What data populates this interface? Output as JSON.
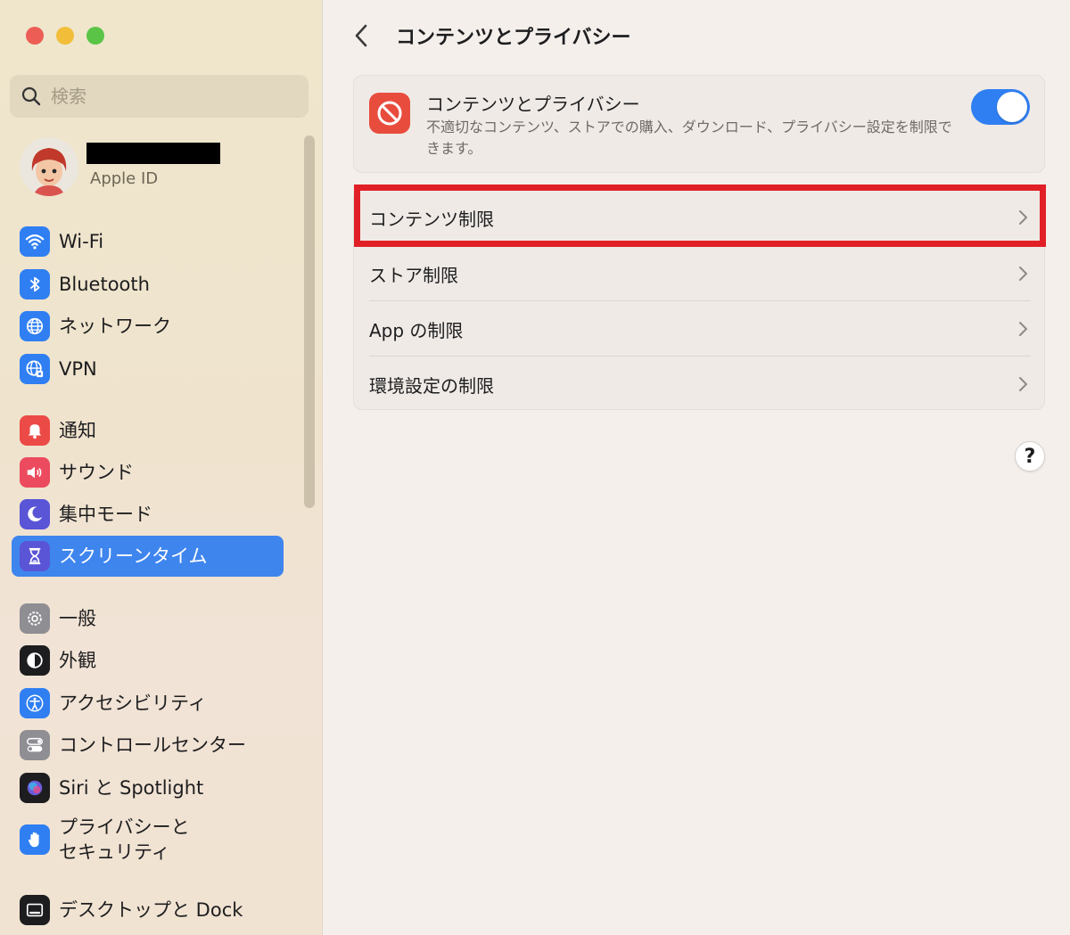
{
  "window": {
    "title": "コンテンツとプライバシー"
  },
  "search": {
    "placeholder": "検索"
  },
  "account": {
    "label": "Apple ID"
  },
  "sidebar": {
    "items": [
      {
        "id": "wifi",
        "label": "Wi-Fi",
        "icon": "wifi-icon",
        "color": "#2f7ff2"
      },
      {
        "id": "bluetooth",
        "label": "Bluetooth",
        "icon": "bluetooth-icon",
        "color": "#2f7ff2"
      },
      {
        "id": "network",
        "label": "ネットワーク",
        "icon": "globe-icon",
        "color": "#2f7ff2"
      },
      {
        "id": "vpn",
        "label": "VPN",
        "icon": "vpn-globe-icon",
        "color": "#2f7ff2"
      },
      {
        "id": "notifications",
        "label": "通知",
        "icon": "bell-icon",
        "color": "#ec4a47"
      },
      {
        "id": "sound",
        "label": "サウンド",
        "icon": "speaker-icon",
        "color": "#ec4a5e"
      },
      {
        "id": "focus",
        "label": "集中モード",
        "icon": "moon-icon",
        "color": "#5a54d6"
      },
      {
        "id": "screentime",
        "label": "スクリーンタイム",
        "icon": "hourglass-icon",
        "color": "#5a54d6",
        "active": true
      },
      {
        "id": "general",
        "label": "一般",
        "icon": "gear-icon",
        "color": "#8e8e93"
      },
      {
        "id": "appearance",
        "label": "外観",
        "icon": "appearance-icon",
        "color": "#1d1d1f"
      },
      {
        "id": "accessibility",
        "label": "アクセシビリティ",
        "icon": "accessibility-icon",
        "color": "#2f7ff2"
      },
      {
        "id": "controlcenter",
        "label": "コントロールセンター",
        "icon": "toggles-icon",
        "color": "#8e8e93"
      },
      {
        "id": "siri",
        "label": "Siri と Spotlight",
        "icon": "siri-icon",
        "color": "#1d1d1f"
      },
      {
        "id": "privacy",
        "label": "プライバシーと\nセキュリティ",
        "icon": "hand-icon",
        "color": "#2f7ff2"
      },
      {
        "id": "desktop",
        "label": "デスクトップと Dock",
        "icon": "dock-icon",
        "color": "#1d1d1f"
      }
    ]
  },
  "main": {
    "header": {
      "back_icon": "chevron-left-icon",
      "title": "コンテンツとプライバシー"
    },
    "card": {
      "title": "コンテンツとプライバシー",
      "description": "不適切なコンテンツ、ストアでの購入、ダウンロード、プライバシー設定を制限できます。",
      "icon": "restricted-icon",
      "icon_color": "#e84c3d",
      "toggle_on": true
    },
    "rows": [
      {
        "label": "コンテンツ制限"
      },
      {
        "label": "ストア制限"
      },
      {
        "label": "App の制限"
      },
      {
        "label": "環境設定の制限"
      }
    ],
    "help_label": "?"
  }
}
